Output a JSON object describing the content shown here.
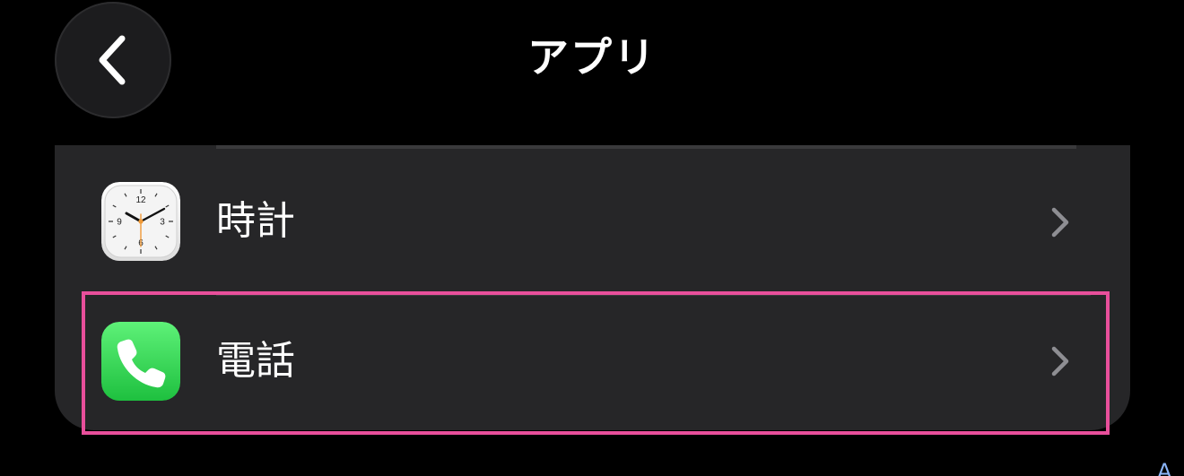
{
  "header": {
    "title": "アプリ",
    "back_icon": "chevron-left-icon"
  },
  "list": {
    "items": [
      {
        "label": "時計",
        "icon": "clock-app-icon",
        "accessory": "chevron-right-icon",
        "selected": false
      },
      {
        "label": "電話",
        "icon": "phone-app-icon",
        "accessory": "chevron-right-icon",
        "selected": true
      }
    ]
  },
  "corner_glyph": "A",
  "colors": {
    "background": "#000000",
    "card": "#262628",
    "highlight": "#e84f9b",
    "phone_green": "#34c759",
    "chevron": "#8e8e93"
  }
}
